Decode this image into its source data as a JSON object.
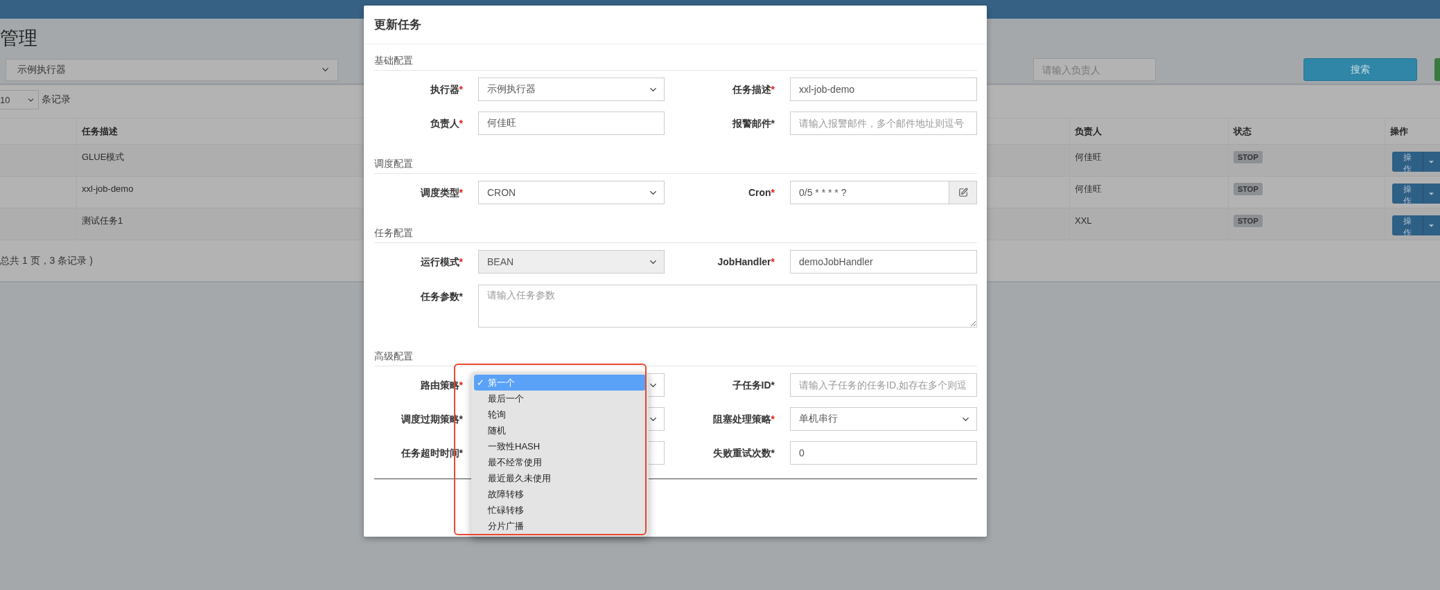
{
  "page": {
    "title": "管理",
    "executor_select": "示例执行器",
    "owner_search": {
      "placeholder": "请输入负责人"
    },
    "search_button": "搜索",
    "page_size": "10",
    "page_size_label": "条记录",
    "table": {
      "columns": [
        "任务描述",
        "负责人",
        "状态",
        "操作"
      ],
      "rows": [
        {
          "description": "GLUE模式",
          "owner": "何佳旺",
          "status": "STOP",
          "action": "操作"
        },
        {
          "description": "xxl-job-demo",
          "owner": "何佳旺",
          "status": "STOP",
          "action": "操作"
        },
        {
          "description": "测试任务1",
          "owner": "XXL",
          "status": "STOP",
          "action": "操作"
        }
      ]
    },
    "footer": "总共 1 页，3 条记录 )"
  },
  "dialog": {
    "title": "更新任务",
    "sections": [
      {
        "legend": "基础配置",
        "rows": [
          [
            {
              "label": "执行器",
              "mark": "*",
              "red_mark": true,
              "kind": "select",
              "disabled": false,
              "value": "示例执行器"
            },
            {
              "label": "任务描述",
              "mark": "*",
              "red_mark": true,
              "kind": "input",
              "value": "xxl-job-demo"
            }
          ],
          [
            {
              "label": "负责人",
              "mark": "*",
              "red_mark": true,
              "kind": "input",
              "value": "何佳旺"
            },
            {
              "label": "报警邮件",
              "mark": "*",
              "red_mark": false,
              "kind": "input",
              "placeholder": "请输入报警邮件，多个邮件地址则逗号"
            }
          ]
        ]
      },
      {
        "legend": "调度配置",
        "rows": [
          [
            {
              "label": "调度类型",
              "mark": "*",
              "red_mark": true,
              "kind": "select",
              "disabled": false,
              "value": "CRON"
            },
            {
              "label": "Cron",
              "mark": "*",
              "red_mark": true,
              "kind": "cron",
              "value": "0/5 * * * * ?"
            }
          ]
        ]
      },
      {
        "legend": "任务配置",
        "rows": [
          [
            {
              "label": "运行模式",
              "mark": "*",
              "red_mark": true,
              "kind": "select",
              "disabled": true,
              "value": "BEAN"
            },
            {
              "label": "JobHandler",
              "mark": "*",
              "red_mark": true,
              "kind": "input",
              "value": "demoJobHandler"
            }
          ],
          [
            {
              "label": "任务参数",
              "mark": "*",
              "red_mark": false,
              "kind": "textarea",
              "placeholder": "请输入任务参数"
            }
          ]
        ]
      },
      {
        "legend": "高级配置",
        "rows": [
          [
            {
              "label": "路由策略",
              "mark": "*",
              "red_mark": true,
              "kind": "select",
              "disabled": false
            },
            {
              "label": "子任务ID",
              "mark": "*",
              "red_mark": false,
              "kind": "input",
              "placeholder": "请输入子任务的任务ID,如存在多个则逗"
            }
          ],
          [
            {
              "label": "调度过期策略",
              "mark": "*",
              "red_mark": false,
              "kind": "select",
              "disabled": false
            },
            {
              "label": "阻塞处理策略",
              "mark": "*",
              "red_mark": true,
              "kind": "select",
              "disabled": false,
              "value": "单机串行"
            }
          ],
          [
            {
              "label": "任务超时时间",
              "mark": "*",
              "red_mark": false,
              "kind": "input"
            },
            {
              "label": "失败重试次数",
              "mark": "*",
              "red_mark": false,
              "kind": "input",
              "value": "0"
            }
          ]
        ]
      }
    ]
  },
  "dropdown": {
    "check_mark": "✓",
    "options": [
      {
        "label": "第一个",
        "selected": true
      },
      {
        "label": "最后一个",
        "selected": false
      },
      {
        "label": "轮询",
        "selected": false
      },
      {
        "label": "随机",
        "selected": false
      },
      {
        "label": "一致性HASH",
        "selected": false
      },
      {
        "label": "最不经常使用",
        "selected": false
      },
      {
        "label": "最近最久未使用",
        "selected": false
      },
      {
        "label": "故障转移",
        "selected": false
      },
      {
        "label": "忙碌转移",
        "selected": false
      },
      {
        "label": "分片广播",
        "selected": false
      }
    ]
  }
}
